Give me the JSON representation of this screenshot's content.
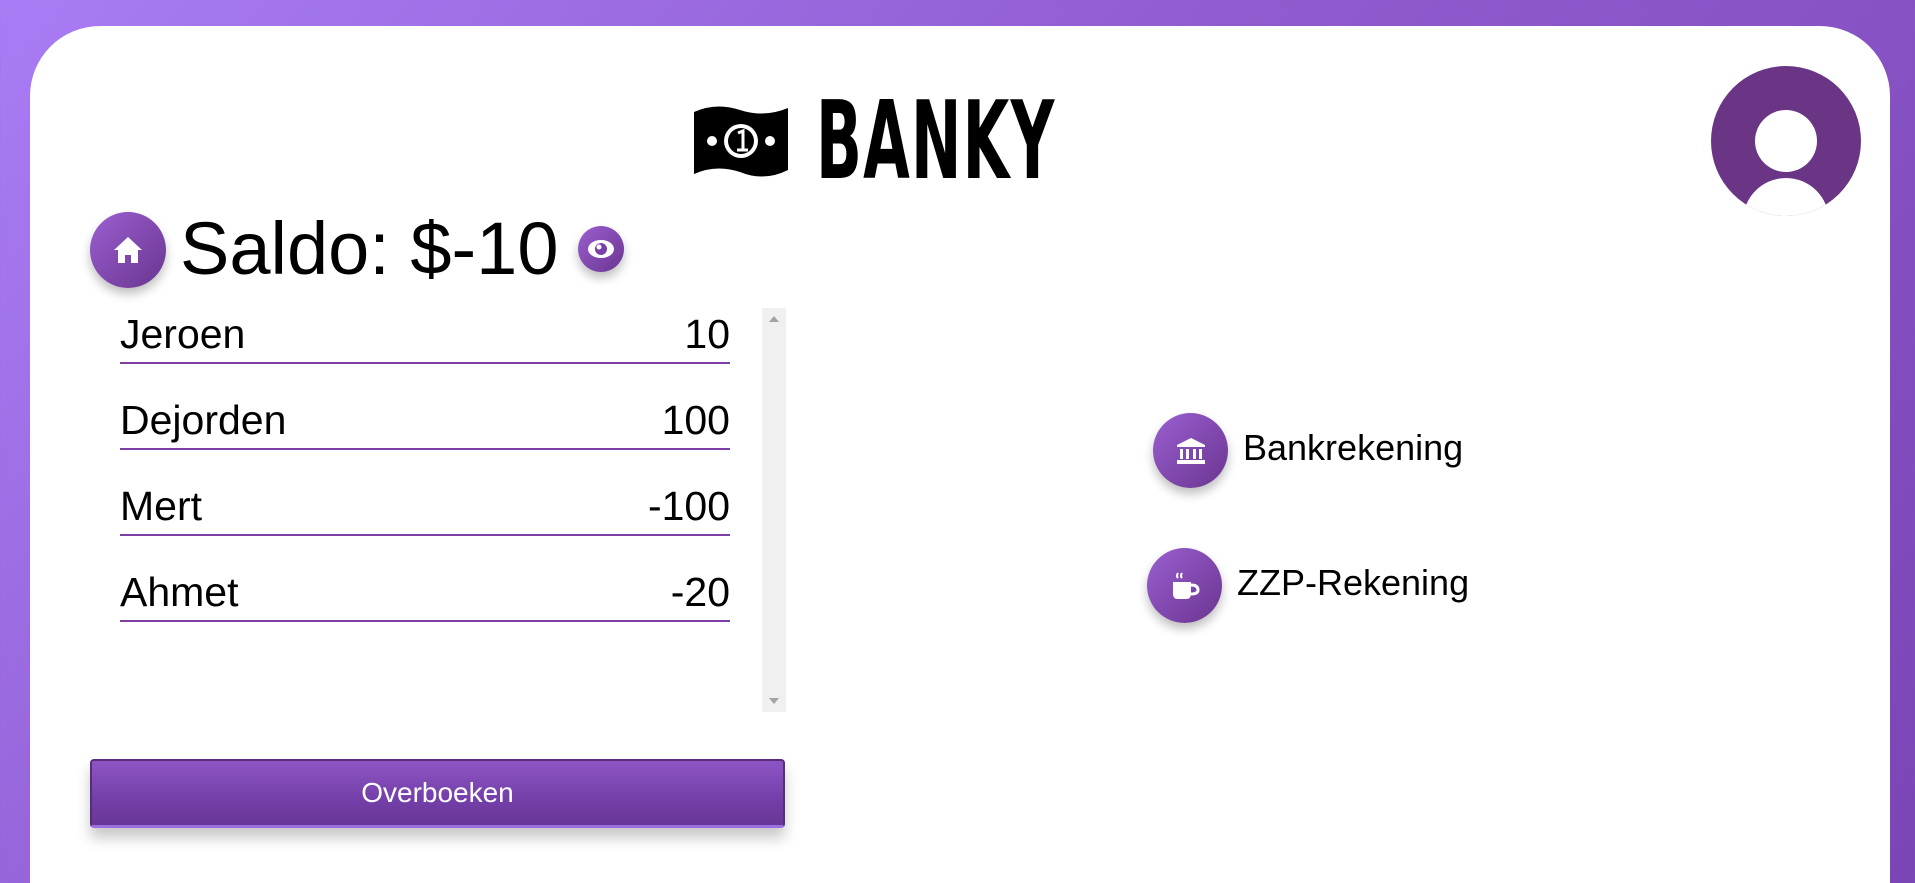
{
  "header": {
    "logo_text": "BANKY",
    "logo_icon": "money-bill-icon",
    "avatar_icon": "user-avatar-icon"
  },
  "balance": {
    "label": "Saldo: $-10",
    "home_icon": "home-icon",
    "toggle_icon": "eye-icon"
  },
  "transactions": [
    {
      "name": "Jeroen",
      "amount": "10"
    },
    {
      "name": "Dejorden",
      "amount": "100"
    },
    {
      "name": "Mert",
      "amount": "-100"
    },
    {
      "name": "Ahmet",
      "amount": "-20"
    }
  ],
  "actions": {
    "transfer_label": "Overboeken"
  },
  "accounts": [
    {
      "label": "Bankrekening",
      "icon": "bank-icon"
    },
    {
      "label": "ZZP-Rekening",
      "icon": "coffee-cup-icon"
    }
  ],
  "colors": {
    "accent": "#7b3fa6",
    "background_gradient_start": "#a97cf5",
    "background_gradient_end": "#7a45b5",
    "avatar": "#6a3585"
  }
}
